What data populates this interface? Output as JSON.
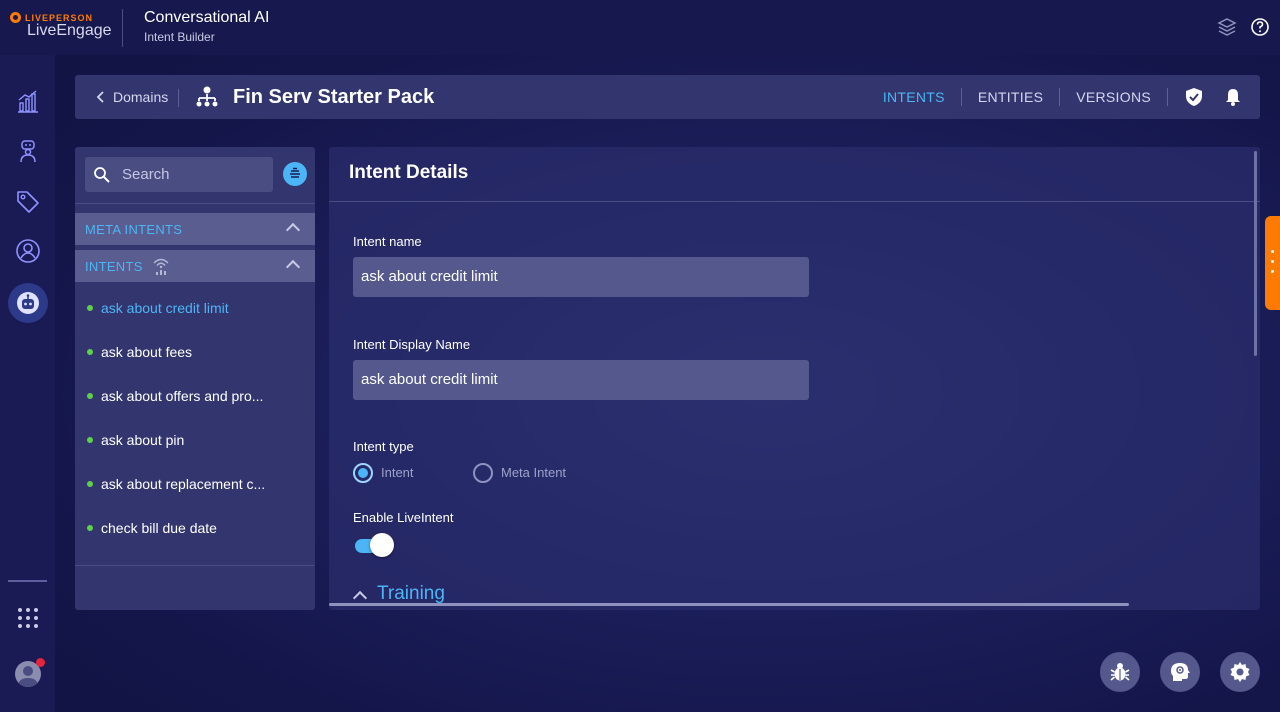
{
  "topbar": {
    "logo_brand": "LIVEPERSON",
    "logo_product": "LiveEngage",
    "app_title": "Conversational AI",
    "app_subtitle": "Intent Builder",
    "icons": [
      "layers-icon",
      "help-icon"
    ]
  },
  "rail": {
    "icons": [
      "analytics-icon",
      "bot-builder-icon",
      "tags-icon",
      "user-icon",
      "intent-builder-icon",
      "apps-grid-icon",
      "avatar"
    ]
  },
  "header": {
    "back_label": "Domains",
    "domain_title": "Fin Serv Starter Pack",
    "tabs": [
      {
        "label": "INTENTS",
        "active": true
      },
      {
        "label": "ENTITIES",
        "active": false
      },
      {
        "label": "VERSIONS",
        "active": false
      }
    ]
  },
  "sidebar": {
    "search_placeholder": "Search",
    "meta_intents_label": "META INTENTS",
    "intents_label": "INTENTS",
    "intents": [
      {
        "label": "ask about credit limit",
        "active": true
      },
      {
        "label": "ask about fees",
        "active": false
      },
      {
        "label": "ask about offers and pro...",
        "active": false
      },
      {
        "label": "ask about pin",
        "active": false
      },
      {
        "label": "ask about replacement c...",
        "active": false
      },
      {
        "label": "check bill due date",
        "active": false
      }
    ]
  },
  "details": {
    "title": "Intent Details",
    "intent_name_label": "Intent name",
    "intent_name_value": "ask about credit limit",
    "display_name_label": "Intent Display Name",
    "display_name_value": "ask about credit limit",
    "intent_type_label": "Intent type",
    "type_options": [
      {
        "label": "Intent",
        "checked": true
      },
      {
        "label": "Meta Intent",
        "checked": false
      }
    ],
    "enable_liveintent_label": "Enable LiveIntent",
    "enable_liveintent_on": true,
    "training_label": "Training"
  },
  "colors": {
    "accent": "#4cb5f5",
    "brand_orange": "#ff7a00",
    "status_green": "#5fcf4e",
    "notification_red": "#e5253b"
  }
}
